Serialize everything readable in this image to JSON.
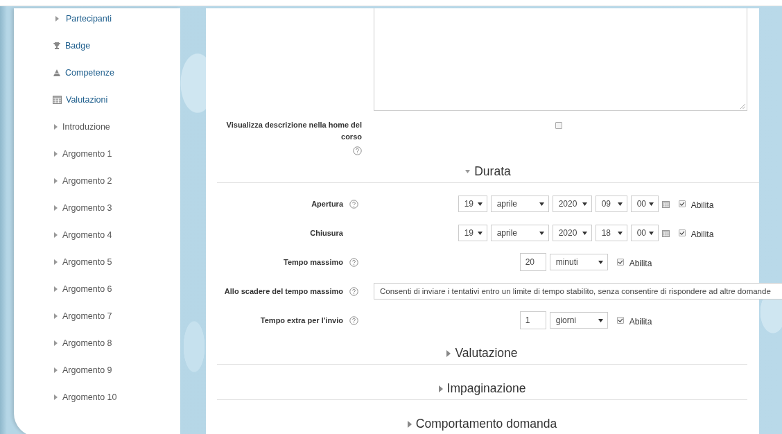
{
  "sidebar": {
    "items": [
      {
        "label": "Partecipanti",
        "kind": "participants"
      },
      {
        "label": "Badge",
        "kind": "badges"
      },
      {
        "label": "Competenze",
        "kind": "competencies"
      },
      {
        "label": "Valutazioni",
        "kind": "grades"
      },
      {
        "label": "Introduzione",
        "kind": "topic"
      },
      {
        "label": "Argomento 1",
        "kind": "topic"
      },
      {
        "label": "Argomento 2",
        "kind": "topic"
      },
      {
        "label": "Argomento 3",
        "kind": "topic"
      },
      {
        "label": "Argomento 4",
        "kind": "topic"
      },
      {
        "label": "Argomento 5",
        "kind": "topic"
      },
      {
        "label": "Argomento 6",
        "kind": "topic"
      },
      {
        "label": "Argomento 7",
        "kind": "topic"
      },
      {
        "label": "Argomento 8",
        "kind": "topic"
      },
      {
        "label": "Argomento 9",
        "kind": "topic"
      },
      {
        "label": "Argomento 10",
        "kind": "topic"
      }
    ]
  },
  "general_rows": [
    {
      "kind": "textarea"
    },
    {
      "kind": "checkbox",
      "label": "Visualizza descrizione nella home del corso",
      "help": true,
      "checked": false
    }
  ],
  "sections": [
    {
      "title": "Durata",
      "expanded": true,
      "rows": [
        {
          "kind": "datetime",
          "label": "Apertura",
          "help": true,
          "day": "19",
          "month": "aprile",
          "year": "2020",
          "hour": "09",
          "minute": "00",
          "enabled": true,
          "enable_label": "Abilita"
        },
        {
          "kind": "datetime",
          "label": "Chiusura",
          "help": false,
          "day": "19",
          "month": "aprile",
          "year": "2020",
          "hour": "18",
          "minute": "00",
          "enabled": true,
          "enable_label": "Abilita"
        },
        {
          "kind": "duration",
          "label": "Tempo massimo",
          "help": true,
          "value": "20",
          "unit": "minuti",
          "enabled": true,
          "enable_label": "Abilita"
        },
        {
          "kind": "select",
          "label": "Allo scadere del tempo massimo",
          "help": true,
          "value": "Consenti di inviare i tentativi entro un limite di tempo stabilito, senza consentire di rispondere ad altre domande"
        },
        {
          "kind": "duration",
          "label": "Tempo extra per l'invio",
          "help": true,
          "value": "1",
          "unit": "giorni",
          "enabled": true,
          "enable_label": "Abilita"
        }
      ]
    },
    {
      "title": "Valutazione",
      "expanded": false
    },
    {
      "title": "Impaginazione",
      "expanded": false
    },
    {
      "title": "Comportamento domanda",
      "expanded": false
    }
  ]
}
